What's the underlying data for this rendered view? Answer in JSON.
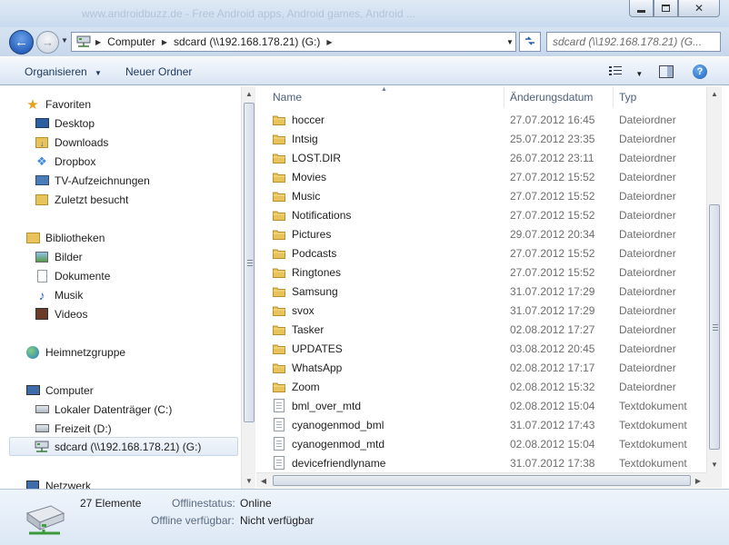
{
  "window": {
    "title_ghost": "www.androidbuzz.de - Free Android apps, Android games, Android ..."
  },
  "nav": {
    "breadcrumb": [
      "Computer",
      "sdcard (\\\\192.168.178.21) (G:)"
    ],
    "search_placeholder": "sdcard (\\\\192.168.178.21) (G..."
  },
  "toolbar": {
    "organize": "Organisieren",
    "new_folder": "Neuer Ordner"
  },
  "sidebar": {
    "favorites": {
      "title": "Favoriten",
      "items": [
        "Desktop",
        "Downloads",
        "Dropbox",
        "TV-Aufzeichnungen",
        "Zuletzt besucht"
      ]
    },
    "libraries": {
      "title": "Bibliotheken",
      "items": [
        "Bilder",
        "Dokumente",
        "Musik",
        "Videos"
      ]
    },
    "homegroup": "Heimnetzgruppe",
    "computer": {
      "title": "Computer",
      "items": [
        "Lokaler Datenträger (C:)",
        "Freizeit (D:)",
        "sdcard (\\\\192.168.178.21) (G:)"
      ]
    },
    "network": "Netzwerk"
  },
  "columns": {
    "name": "Name",
    "date": "Änderungsdatum",
    "type": "Typ"
  },
  "files": [
    {
      "name": "hoccer",
      "date": "27.07.2012 16:45",
      "type": "Dateiordner",
      "kind": "folder"
    },
    {
      "name": "Intsig",
      "date": "25.07.2012 23:35",
      "type": "Dateiordner",
      "kind": "folder"
    },
    {
      "name": "LOST.DIR",
      "date": "26.07.2012 23:11",
      "type": "Dateiordner",
      "kind": "folder"
    },
    {
      "name": "Movies",
      "date": "27.07.2012 15:52",
      "type": "Dateiordner",
      "kind": "folder"
    },
    {
      "name": "Music",
      "date": "27.07.2012 15:52",
      "type": "Dateiordner",
      "kind": "folder"
    },
    {
      "name": "Notifications",
      "date": "27.07.2012 15:52",
      "type": "Dateiordner",
      "kind": "folder"
    },
    {
      "name": "Pictures",
      "date": "29.07.2012 20:34",
      "type": "Dateiordner",
      "kind": "folder"
    },
    {
      "name": "Podcasts",
      "date": "27.07.2012 15:52",
      "type": "Dateiordner",
      "kind": "folder"
    },
    {
      "name": "Ringtones",
      "date": "27.07.2012 15:52",
      "type": "Dateiordner",
      "kind": "folder"
    },
    {
      "name": "Samsung",
      "date": "31.07.2012 17:29",
      "type": "Dateiordner",
      "kind": "folder"
    },
    {
      "name": "svox",
      "date": "31.07.2012 17:29",
      "type": "Dateiordner",
      "kind": "folder"
    },
    {
      "name": "Tasker",
      "date": "02.08.2012 17:27",
      "type": "Dateiordner",
      "kind": "folder"
    },
    {
      "name": "UPDATES",
      "date": "03.08.2012 20:45",
      "type": "Dateiordner",
      "kind": "folder"
    },
    {
      "name": "WhatsApp",
      "date": "02.08.2012 17:17",
      "type": "Dateiordner",
      "kind": "folder"
    },
    {
      "name": "Zoom",
      "date": "02.08.2012 15:32",
      "type": "Dateiordner",
      "kind": "folder"
    },
    {
      "name": "bml_over_mtd",
      "date": "02.08.2012 15:04",
      "type": "Textdokument",
      "kind": "doc"
    },
    {
      "name": "cyanogenmod_bml",
      "date": "31.07.2012 17:43",
      "type": "Textdokument",
      "kind": "doc"
    },
    {
      "name": "cyanogenmod_mtd",
      "date": "02.08.2012 15:04",
      "type": "Textdokument",
      "kind": "doc"
    },
    {
      "name": "devicefriendlyname",
      "date": "31.07.2012 17:38",
      "type": "Textdokument",
      "kind": "doc"
    }
  ],
  "details": {
    "count": "27 Elemente",
    "offline_status_label": "Offlinestatus:",
    "offline_status_value": "Online",
    "offline_avail_label": "Offline verfügbar:",
    "offline_avail_value": "Nicht verfügbar"
  },
  "colors": {
    "folder": "#e8c25a",
    "accent": "#1e395b"
  }
}
